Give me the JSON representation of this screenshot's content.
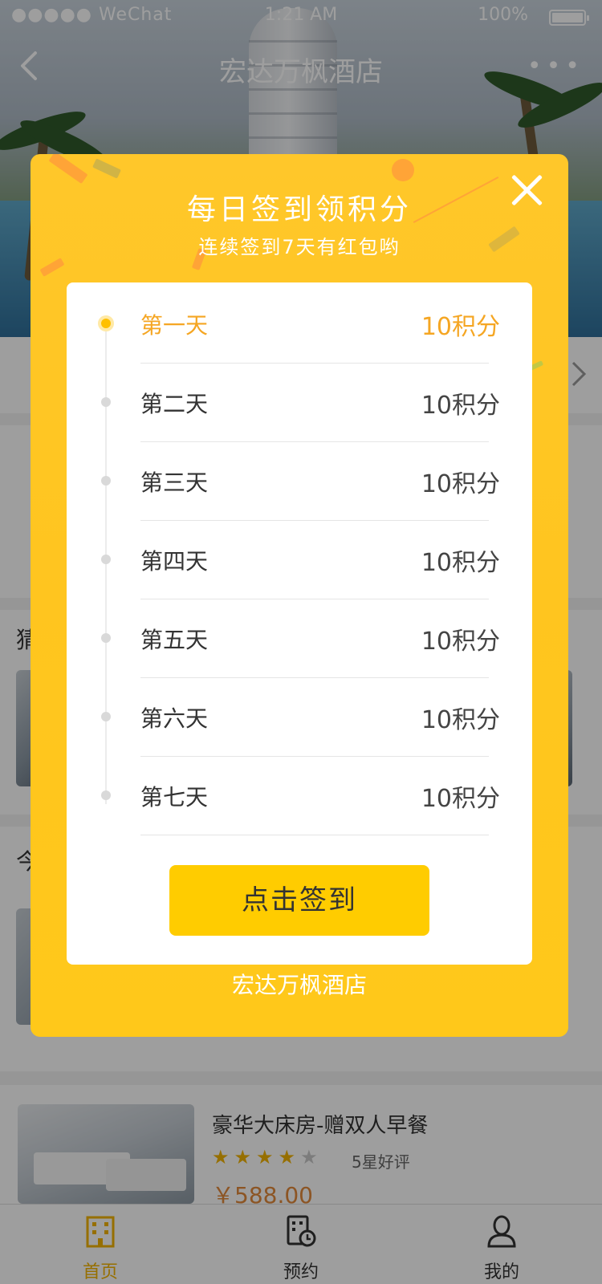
{
  "status_bar": {
    "carrier": "●●●●● WeChat",
    "time": "1:21 AM",
    "battery": "100%"
  },
  "nav": {
    "title": "宏达万枫酒店",
    "more": "•••"
  },
  "modal": {
    "title": "每日签到领积分",
    "subtitle": "连续签到7天有红包哟",
    "days": [
      {
        "label": "第一天",
        "points": "10积分",
        "active": true
      },
      {
        "label": "第二天",
        "points": "10积分",
        "active": false
      },
      {
        "label": "第三天",
        "points": "10积分",
        "active": false
      },
      {
        "label": "第四天",
        "points": "10积分",
        "active": false
      },
      {
        "label": "第五天",
        "points": "10积分",
        "active": false
      },
      {
        "label": "第六天",
        "points": "10积分",
        "active": false
      },
      {
        "label": "第七天",
        "points": "10积分",
        "active": false
      }
    ],
    "button_label": "点击签到",
    "footer": "宏达万枫酒店"
  },
  "background_sections": {
    "section_a_fragment": "猜",
    "section_b_fragment": "今"
  },
  "room_card": {
    "name": "豪华大床房-赠双人早餐",
    "stars_filled": 4,
    "stars_total": 5,
    "rating_text": "5星好评",
    "price": "￥588.00"
  },
  "tabbar": {
    "tabs": [
      {
        "label": "首页",
        "active": true
      },
      {
        "label": "预约",
        "active": false
      },
      {
        "label": "我的",
        "active": false
      }
    ]
  },
  "colors": {
    "modal_yellow": "#ffc72a",
    "button_yellow": "#ffcc00",
    "accent_orange": "#f5a623",
    "tab_active": "#f2b300"
  }
}
